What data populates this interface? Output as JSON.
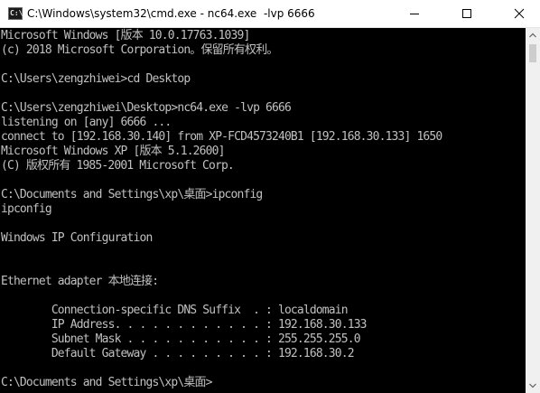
{
  "window": {
    "title": "C:\\Windows\\system32\\cmd.exe - nc64.exe  -lvp 6666",
    "icon_label": "C:\\",
    "icon": "cmd-icon",
    "buttons": [
      "minimize-icon",
      "maximize-icon",
      "close-icon"
    ]
  },
  "console": {
    "lines": [
      "Microsoft Windows [版本 10.0.17763.1039]",
      "(c) 2018 Microsoft Corporation。保留所有权利。",
      "",
      "C:\\Users\\zengzhiwei>cd Desktop",
      "",
      "C:\\Users\\zengzhiwei\\Desktop>nc64.exe -lvp 6666",
      "listening on [any] 6666 ...",
      "connect to [192.168.30.140] from XP-FCD4573240B1 [192.168.30.133] 1650",
      "Microsoft Windows XP [版本 5.1.2600]",
      "(C) 版权所有 1985-2001 Microsoft Corp.",
      "",
      "C:\\Documents and Settings\\xp\\桌面>ipconfig",
      "ipconfig",
      "",
      "Windows IP Configuration",
      "",
      "",
      "Ethernet adapter 本地连接:",
      "",
      "        Connection-specific DNS Suffix  . : localdomain",
      "        IP Address. . . . . . . . . . . . : 192.168.30.133",
      "        Subnet Mask . . . . . . . . . . . : 255.255.255.0",
      "        Default Gateway . . . . . . . . . : 192.168.30.2",
      "",
      "C:\\Documents and Settings\\xp\\桌面>"
    ],
    "colors": {
      "background": "#000000",
      "text": "#c0c0c0"
    }
  },
  "scrollbar": {
    "arrows": [
      "scroll-up-arrow-icon",
      "scroll-down-arrow-icon"
    ]
  }
}
